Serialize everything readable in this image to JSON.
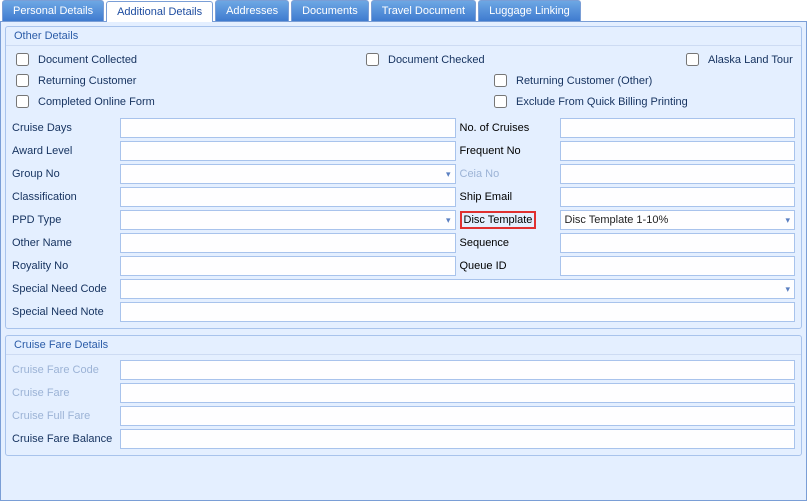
{
  "tabs": {
    "personal": "Personal Details",
    "additional": "Additional Details",
    "addresses": "Addresses",
    "documents": "Documents",
    "travel": "Travel Document",
    "luggage": "Luggage Linking"
  },
  "groups": {
    "other_details": "Other Details",
    "fare_details": "Cruise Fare Details"
  },
  "checks": {
    "doc_collected": "Document Collected",
    "doc_checked": "Document Checked",
    "alaska": "Alaska Land Tour",
    "returning": "Returning Customer",
    "returning_other": "Returning Customer (Other)",
    "completed_online": "Completed Online Form",
    "exclude_billing": "Exclude From Quick Billing Printing"
  },
  "labels": {
    "cruise_days": "Cruise Days",
    "no_cruises": "No. of Cruises",
    "award_level": "Award Level",
    "frequent_no": "Frequent No",
    "group_no": "Group No",
    "ceia_no": "Ceia No",
    "classification": "Classification",
    "ship_email": "Ship Email",
    "ppd_type": "PPD Type",
    "disc_template": "Disc Template",
    "other_name": "Other Name",
    "sequence": "Sequence",
    "royality_no": "Royality No",
    "queue_id": "Queue ID",
    "special_need_code": "Special Need Code",
    "special_need_note": "Special Need Note",
    "cruise_fare_code": "Cruise Fare Code",
    "cruise_fare": "Cruise Fare",
    "cruise_full_fare": "Cruise Full Fare",
    "cruise_fare_balance": "Cruise Fare Balance"
  },
  "values": {
    "cruise_days": "",
    "no_cruises": "",
    "award_level": "",
    "frequent_no": "",
    "group_no": "",
    "ceia_no": "",
    "classification": "",
    "ship_email": "",
    "ppd_type": "",
    "disc_template": "Disc Template 1-10%",
    "other_name": "",
    "sequence": "",
    "royality_no": "",
    "queue_id": "",
    "special_need_code": "",
    "special_need_note": "",
    "cruise_fare_code": "",
    "cruise_fare": "",
    "cruise_full_fare": "",
    "cruise_fare_balance": ""
  }
}
